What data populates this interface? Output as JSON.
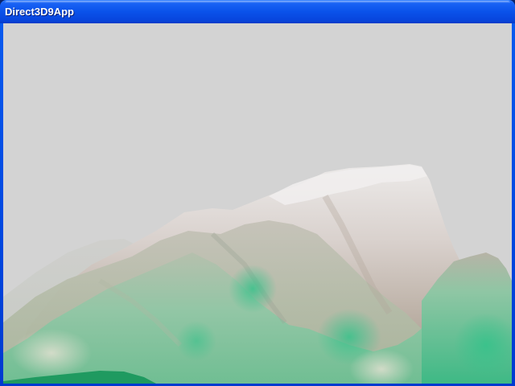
{
  "window": {
    "title": "Direct3D9App"
  },
  "scene": {
    "background_color": "#d3d3d3",
    "fog_color": "#d3d3d3",
    "description_colors": {
      "snow": "#e8e4e2",
      "rock": "#a89a90",
      "grass": "#3fbf88",
      "dark_grass": "#1f9a60"
    }
  }
}
